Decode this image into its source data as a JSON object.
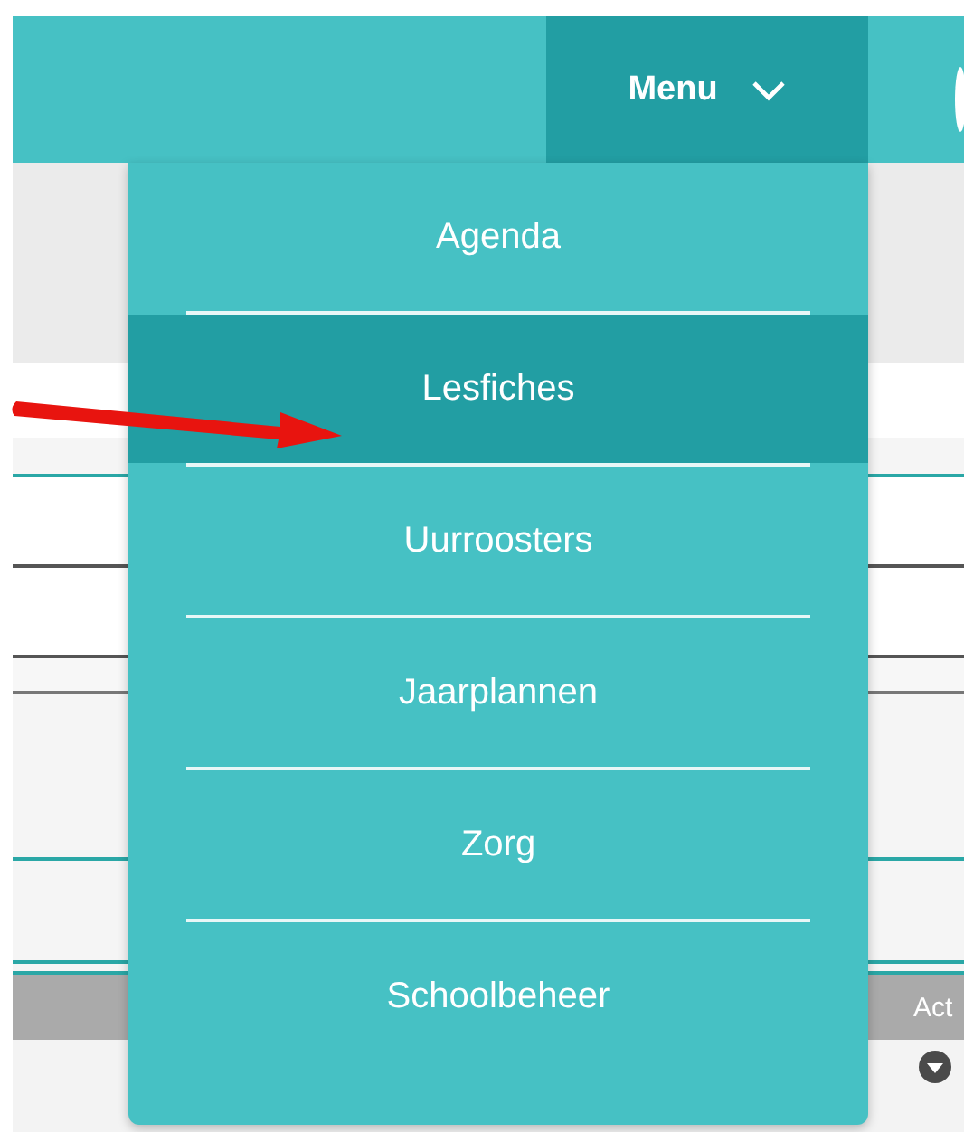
{
  "header": {
    "menu_button": {
      "label": "Menu",
      "expanded": true
    }
  },
  "menu_items": [
    {
      "label": "Agenda",
      "selected": false
    },
    {
      "label": "Lesfiches",
      "selected": true
    },
    {
      "label": "Uurroosters",
      "selected": false
    },
    {
      "label": "Jaarplannen",
      "selected": false
    },
    {
      "label": "Zorg",
      "selected": false
    },
    {
      "label": "Schoolbeheer",
      "selected": false
    }
  ],
  "table": {
    "columns": [
      "Act"
    ]
  }
}
